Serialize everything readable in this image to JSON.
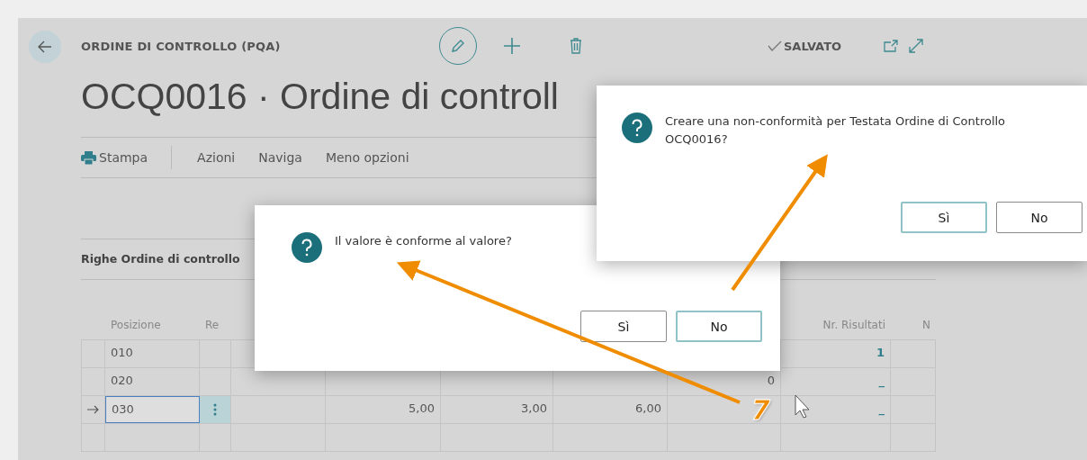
{
  "header": {
    "breadcrumb": "ORDINE DI CONTROLLO (PQA)",
    "status": "SALVATO",
    "title": "OCQ0016 · Ordine di controll"
  },
  "actions": [
    {
      "label": "Stampa",
      "kind": "print"
    },
    {
      "label": "Azioni",
      "kind": "plain"
    },
    {
      "label": "Naviga",
      "kind": "plain"
    },
    {
      "label": "Meno opzioni",
      "kind": "plain"
    }
  ],
  "section": {
    "title": "Righe Ordine di controllo"
  },
  "table": {
    "columns": [
      "Posizione",
      "Re",
      "",
      "",
      "",
      "",
      "Nr. Risultati",
      "N"
    ],
    "rows": [
      {
        "selected": false,
        "cells": [
          "010",
          "",
          "",
          "",
          "",
          "",
          "1",
          ""
        ]
      },
      {
        "selected": false,
        "cells": [
          "020",
          "",
          "",
          "",
          "",
          "0",
          "_",
          ""
        ]
      },
      {
        "selected": true,
        "cells": [
          "030",
          "",
          "5,00",
          "3,00",
          "6,00",
          "",
          "_",
          ""
        ]
      },
      {
        "selected": false,
        "cells": [
          "",
          "",
          "",
          "",
          "",
          "",
          "",
          ""
        ]
      }
    ]
  },
  "dialogs": [
    {
      "message": "Il valore è conforme al valore?",
      "buttons": [
        {
          "label": "Sì",
          "focused": false
        },
        {
          "label": "No",
          "focused": true
        }
      ]
    },
    {
      "message": "Creare una non-conformità per Testata Ordine di Controllo OCQ0016?",
      "buttons": [
        {
          "label": "Sì",
          "focused": true
        },
        {
          "label": "No",
          "focused": false
        }
      ]
    }
  ],
  "annotation": {
    "step": "7"
  }
}
